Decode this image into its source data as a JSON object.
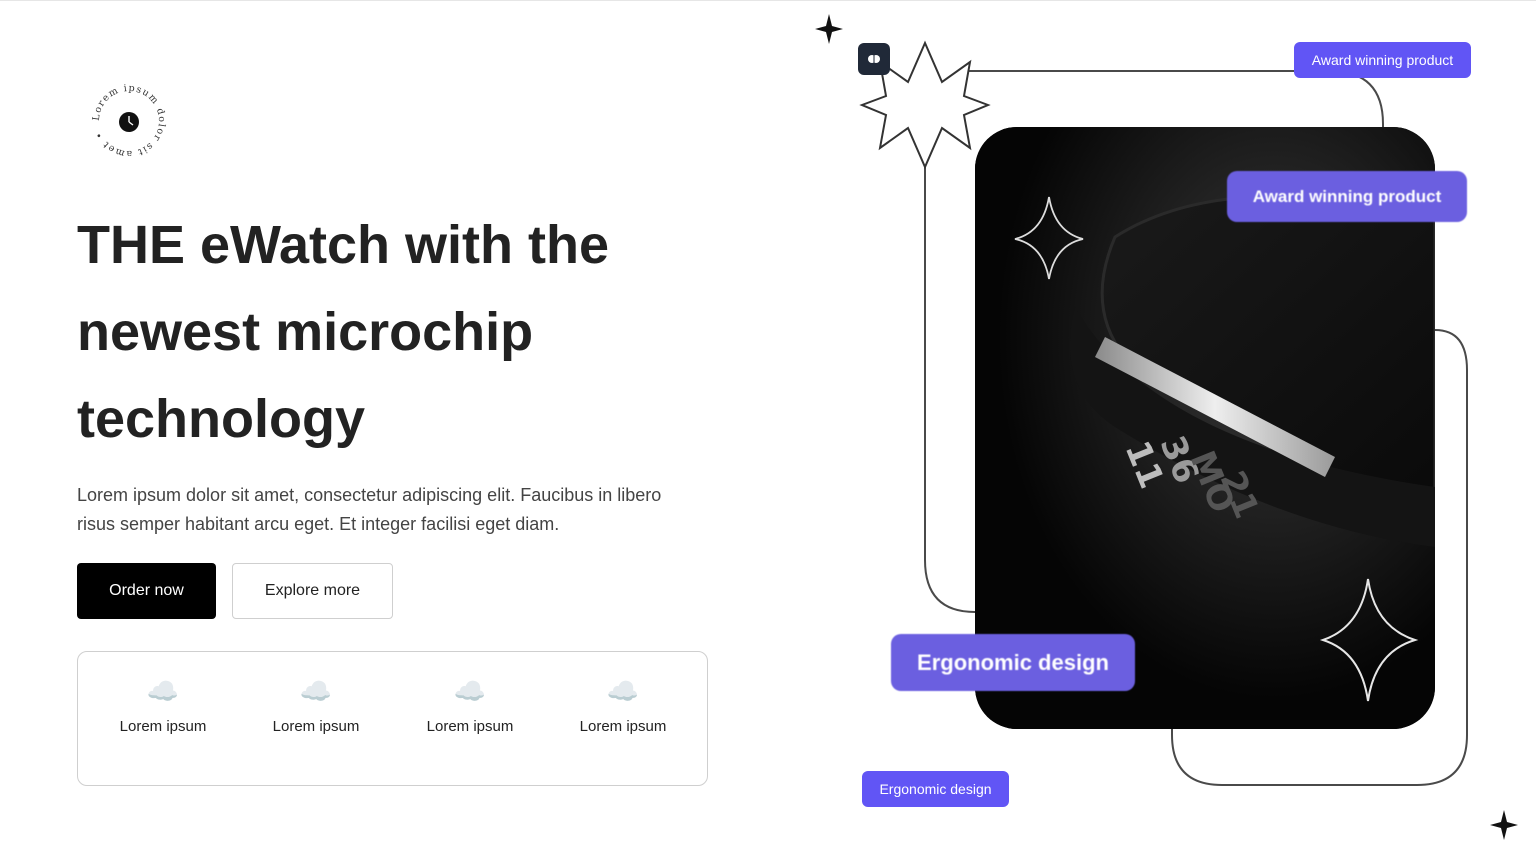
{
  "badge": {
    "ring_text": "Lorem ipsum dolor sit amet • ",
    "icon": "clock-icon"
  },
  "hero": {
    "headline_line1": "THE eWatch with the",
    "headline_line2": "newest microchip",
    "headline_line3": "technology",
    "subtitle": "Lorem ipsum dolor sit amet, consectetur adipiscing elit. Faucibus in libero risus semper habitant arcu eget. Et integer facilisi eget diam."
  },
  "buttons": {
    "primary": "Order now",
    "secondary": "Explore more"
  },
  "features": [
    {
      "icon": "cloud-icon",
      "glyph": "☁️",
      "label": "Lorem ipsum"
    },
    {
      "icon": "cloud-icon",
      "glyph": "☁️",
      "label": "Lorem ipsum"
    },
    {
      "icon": "cloud-icon",
      "glyph": "☁️",
      "label": "Lorem ipsum"
    },
    {
      "icon": "cloud-icon",
      "glyph": "☁️",
      "label": "Lorem ipsum"
    }
  ],
  "tags": {
    "award": "Award winning product",
    "ergonomic": "Ergonomic design"
  },
  "watch_display": {
    "hour": "11",
    "minute": "36",
    "day": "MO",
    "date": "21"
  },
  "colors": {
    "accent": "#6155f5",
    "dark": "#000000",
    "chip": "#202938"
  }
}
